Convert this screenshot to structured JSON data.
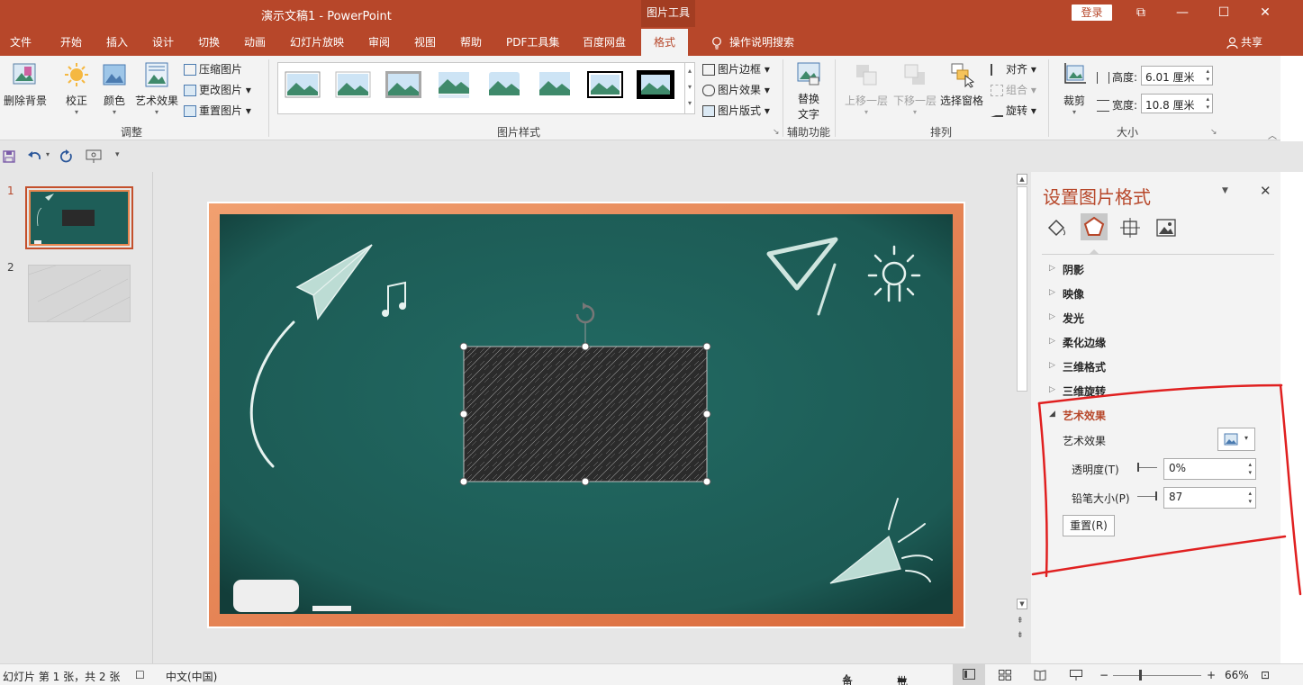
{
  "window": {
    "title": "演示文稿1  -  PowerPoint",
    "context_tab_group": "图片工具",
    "login_label": "登录",
    "controls": [
      "⧉",
      "—",
      "☐",
      "✕"
    ]
  },
  "tabs": {
    "items": [
      "文件",
      "开始",
      "插入",
      "设计",
      "切换",
      "动画",
      "幻灯片放映",
      "审阅",
      "视图",
      "帮助",
      "PDF工具集",
      "百度网盘",
      "格式"
    ],
    "active": "格式",
    "search_label": "操作说明搜索",
    "share_label": "共享"
  },
  "ribbon": {
    "adjust": {
      "remove_bg": "删除背景",
      "corrections": "校正",
      "color": "颜色",
      "artistic": "艺术效果",
      "compress": "压缩图片",
      "change": "更改图片",
      "reset": "重置图片",
      "label": "调整"
    },
    "styles": {
      "label": "图片样式",
      "border": "图片边框",
      "effects": "图片效果",
      "layout": "图片版式"
    },
    "accessibility": {
      "alt_text_line1": "替换",
      "alt_text_line2": "文字",
      "label": "辅助功能"
    },
    "arrange": {
      "bring_forward": "上移一层",
      "send_backward": "下移一层",
      "selection_pane": "选择窗格",
      "align": "对齐",
      "group": "组合",
      "rotate": "旋转",
      "label": "排列"
    },
    "size": {
      "crop": "裁剪",
      "height_label": "高度:",
      "height_value": "6.01 厘米",
      "width_label": "宽度:",
      "width_value": "10.8 厘米",
      "label": "大小"
    }
  },
  "slides": {
    "items": [
      {
        "number": "1",
        "selected": true
      },
      {
        "number": "2",
        "selected": false
      }
    ]
  },
  "pane": {
    "title": "设置图片格式",
    "sections": [
      "阴影",
      "映像",
      "发光",
      "柔化边缘",
      "三维格式",
      "三维旋转"
    ],
    "expanded_section": "艺术效果",
    "artistic_effect_label": "艺术效果",
    "transparency_label": "透明度(T)",
    "transparency_value": "0%",
    "pencil_size_label": "铅笔大小(P)",
    "pencil_size_value": "87",
    "reset_label": "重置(R)"
  },
  "status": {
    "slide_info": "幻灯片 第 1 张，共 2 张",
    "language": "中文(中国)",
    "notes": "备注",
    "comments": "批注",
    "zoom": "66%"
  },
  "colors": {
    "accent": "#b7472a",
    "chalkboard": "#1e5e58",
    "frame": "#e8864f",
    "annotation": "#e02020"
  }
}
